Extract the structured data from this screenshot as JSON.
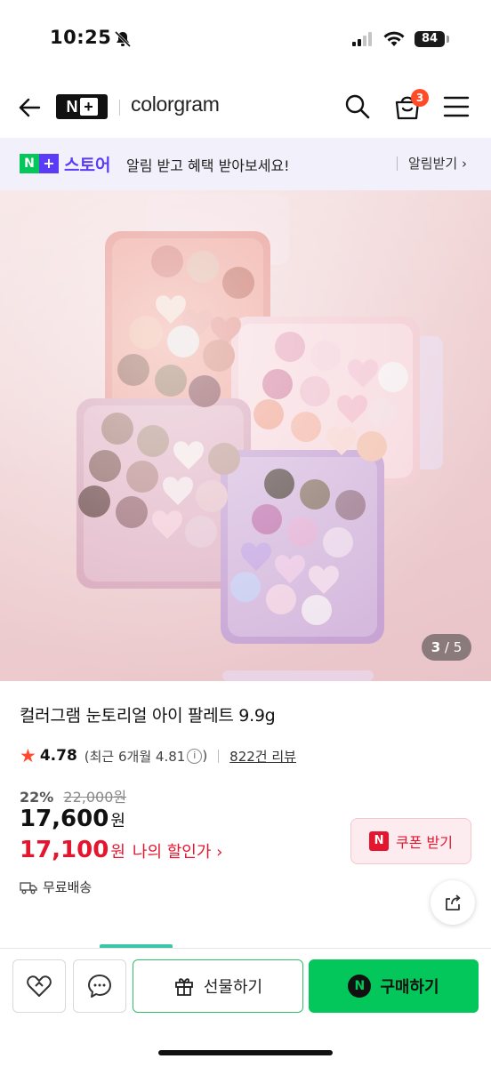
{
  "status_bar": {
    "time": "10:25",
    "battery": "84"
  },
  "header": {
    "logo": "N",
    "brand": "colorgram",
    "cart_count": "3"
  },
  "banner": {
    "store": "스토어",
    "message": "알림 받고 혜택 받아보세요!",
    "cta": "알림받기 ›"
  },
  "hero": {
    "current": "3",
    "total": "5"
  },
  "product": {
    "title": "컬러그램 눈토리얼 아이 팔레트 9.9g",
    "rating": "4.78",
    "recent_rating": "(최근 6개월 4.81",
    "review_count": "822건 리뷰",
    "discount_pct": "22%",
    "original_price": "22,000원",
    "price": "17,600",
    "won": "원",
    "my_price": "17,100",
    "my_price_label": "나의 할인가 ›",
    "coupon": "쿠폰 받기",
    "shipping": "무료배송"
  },
  "bottom_bar": {
    "gift": "선물하기",
    "buy": "구매하기"
  },
  "colors": {
    "naver_green": "#03c75a",
    "plus_purple": "#5b3cf6",
    "price_red": "#e4162f",
    "badge": "#ff4b26"
  }
}
